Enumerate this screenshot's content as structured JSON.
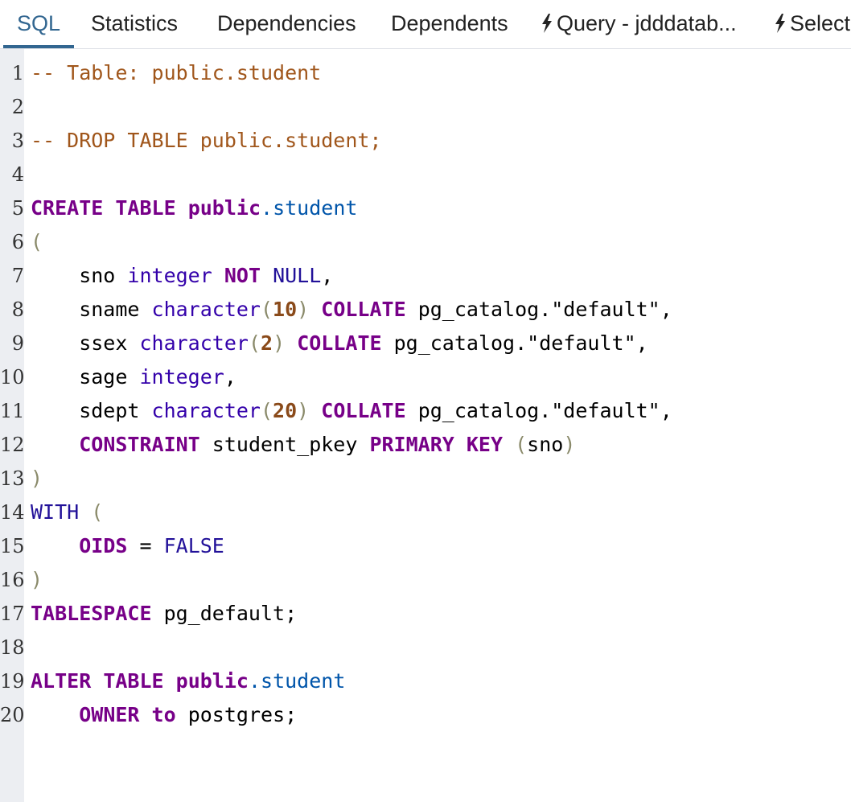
{
  "tabs": [
    {
      "label": "SQL",
      "active": true,
      "icon": null
    },
    {
      "label": "Statistics",
      "active": false,
      "icon": null
    },
    {
      "label": "Dependencies",
      "active": false,
      "icon": null
    },
    {
      "label": "Dependents",
      "active": false,
      "icon": null
    },
    {
      "label": "Query - jdddatab...",
      "active": false,
      "icon": "bolt-icon"
    },
    {
      "label": "Select",
      "active": false,
      "icon": "bolt-icon"
    }
  ],
  "colors": {
    "accent": "#326690",
    "gutter": "#eceef2",
    "comment": "#a0561b",
    "keyword": "#770088",
    "type": "#3300aa",
    "identifier": "#0055aa"
  },
  "editor": {
    "lines": [
      {
        "n": "1",
        "tokens": [
          {
            "t": "-- Table: public.student",
            "c": "comment"
          }
        ]
      },
      {
        "n": "2",
        "tokens": []
      },
      {
        "n": "3",
        "tokens": [
          {
            "t": "-- DROP TABLE public.student;",
            "c": "comment"
          }
        ]
      },
      {
        "n": "4",
        "tokens": []
      },
      {
        "n": "5",
        "tokens": [
          {
            "t": "CREATE",
            "c": "kw"
          },
          {
            "t": " ",
            "c": "plain"
          },
          {
            "t": "TABLE",
            "c": "kw"
          },
          {
            "t": " ",
            "c": "plain"
          },
          {
            "t": "public",
            "c": "kw"
          },
          {
            "t": ".student",
            "c": "ident"
          }
        ]
      },
      {
        "n": "6",
        "tokens": [
          {
            "t": "(",
            "c": "paren"
          }
        ]
      },
      {
        "n": "7",
        "tokens": [
          {
            "t": "    sno ",
            "c": "plain"
          },
          {
            "t": "integer",
            "c": "type"
          },
          {
            "t": " ",
            "c": "plain"
          },
          {
            "t": "NOT",
            "c": "kw"
          },
          {
            "t": " ",
            "c": "plain"
          },
          {
            "t": "NULL",
            "c": "const"
          },
          {
            "t": ",",
            "c": "plain"
          }
        ]
      },
      {
        "n": "8",
        "tokens": [
          {
            "t": "    sname ",
            "c": "plain"
          },
          {
            "t": "character",
            "c": "type"
          },
          {
            "t": "(",
            "c": "paren"
          },
          {
            "t": "10",
            "c": "num"
          },
          {
            "t": ")",
            "c": "paren"
          },
          {
            "t": " ",
            "c": "plain"
          },
          {
            "t": "COLLATE",
            "c": "kw"
          },
          {
            "t": " pg_catalog.\"default\",",
            "c": "plain"
          }
        ]
      },
      {
        "n": "9",
        "tokens": [
          {
            "t": "    ssex ",
            "c": "plain"
          },
          {
            "t": "character",
            "c": "type"
          },
          {
            "t": "(",
            "c": "paren"
          },
          {
            "t": "2",
            "c": "num"
          },
          {
            "t": ")",
            "c": "paren"
          },
          {
            "t": " ",
            "c": "plain"
          },
          {
            "t": "COLLATE",
            "c": "kw"
          },
          {
            "t": " pg_catalog.\"default\",",
            "c": "plain"
          }
        ]
      },
      {
        "n": "10",
        "tokens": [
          {
            "t": "    sage ",
            "c": "plain"
          },
          {
            "t": "integer",
            "c": "type"
          },
          {
            "t": ",",
            "c": "plain"
          }
        ]
      },
      {
        "n": "11",
        "tokens": [
          {
            "t": "    sdept ",
            "c": "plain"
          },
          {
            "t": "character",
            "c": "type"
          },
          {
            "t": "(",
            "c": "paren"
          },
          {
            "t": "20",
            "c": "num"
          },
          {
            "t": ")",
            "c": "paren"
          },
          {
            "t": " ",
            "c": "plain"
          },
          {
            "t": "COLLATE",
            "c": "kw"
          },
          {
            "t": " pg_catalog.\"default\",",
            "c": "plain"
          }
        ]
      },
      {
        "n": "12",
        "tokens": [
          {
            "t": "    ",
            "c": "plain"
          },
          {
            "t": "CONSTRAINT",
            "c": "kw"
          },
          {
            "t": " student_pkey ",
            "c": "plain"
          },
          {
            "t": "PRIMARY",
            "c": "kw"
          },
          {
            "t": " ",
            "c": "plain"
          },
          {
            "t": "KEY",
            "c": "kw"
          },
          {
            "t": " ",
            "c": "plain"
          },
          {
            "t": "(",
            "c": "paren"
          },
          {
            "t": "sno",
            "c": "plain"
          },
          {
            "t": ")",
            "c": "paren"
          }
        ]
      },
      {
        "n": "13",
        "tokens": [
          {
            "t": ")",
            "c": "paren"
          }
        ]
      },
      {
        "n": "14",
        "tokens": [
          {
            "t": "WITH",
            "c": "const"
          },
          {
            "t": " ",
            "c": "plain"
          },
          {
            "t": "(",
            "c": "paren"
          }
        ]
      },
      {
        "n": "15",
        "tokens": [
          {
            "t": "    ",
            "c": "plain"
          },
          {
            "t": "OIDS",
            "c": "kw"
          },
          {
            "t": " = ",
            "c": "plain"
          },
          {
            "t": "FALSE",
            "c": "const"
          }
        ]
      },
      {
        "n": "16",
        "tokens": [
          {
            "t": ")",
            "c": "paren"
          }
        ]
      },
      {
        "n": "17",
        "tokens": [
          {
            "t": "TABLESPACE",
            "c": "kw"
          },
          {
            "t": " pg_default;",
            "c": "plain"
          }
        ]
      },
      {
        "n": "18",
        "tokens": []
      },
      {
        "n": "19",
        "tokens": [
          {
            "t": "ALTER",
            "c": "kw"
          },
          {
            "t": " ",
            "c": "plain"
          },
          {
            "t": "TABLE",
            "c": "kw"
          },
          {
            "t": " ",
            "c": "plain"
          },
          {
            "t": "public",
            "c": "kw"
          },
          {
            "t": ".student",
            "c": "ident"
          }
        ]
      },
      {
        "n": "20",
        "tokens": [
          {
            "t": "    ",
            "c": "plain"
          },
          {
            "t": "OWNER",
            "c": "kw"
          },
          {
            "t": " ",
            "c": "plain"
          },
          {
            "t": "to",
            "c": "kw"
          },
          {
            "t": " postgres;",
            "c": "plain"
          }
        ]
      }
    ]
  }
}
